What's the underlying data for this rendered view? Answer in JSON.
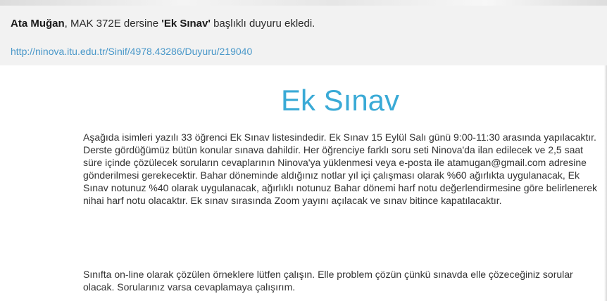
{
  "notice": {
    "author": "Ata Muğan",
    "text_before_title": ", MAK 372E dersine ",
    "title_quoted": "'Ek Sınav'",
    "text_after_title": " başlıklı duyuru ekledi.",
    "link": "http://ninova.itu.edu.tr/Sinif/4978.43286/Duyuru/219040"
  },
  "announcement": {
    "title": "Ek Sınav",
    "paragraph_1": "Aşağıda isimleri yazılı 33 öğrenci Ek Sınav listesindedir. Ek Sınav 15 Eylül Salı günü 9:00-11:30 arasında yapılacaktır. Derste gördüğümüz bütün konular sınava dahildir. Her öğrenciye farklı soru seti Ninova'da ilan edilecek ve 2,5 saat süre içinde çözülecek soruların cevaplarının Ninova'ya yüklenmesi veya e-posta ile atamugan@gmail.com adresine gönderilmesi gerekecektir. Bahar döneminde aldığınız notlar yıl içi çalışması olarak %60 ağırlıkta uygulanacak, Ek Sınav notunuz %40 olarak uygulanacak, ağırlıklı notunuz Bahar dönemi harf notu değerlendirmesine göre belirlenerek nihai harf notu olacaktır. Ek sınav sırasında Zoom yayını açılacak ve sınav bitince kapatılacaktır.",
    "paragraph_2": "Sınıfta on-line olarak çözülen örneklere lütfen çalışın. Elle problem çözün çünkü sınavda elle çözeceğiniz sorular olacak. Sorularınız varsa cevaplamaya çalışırım."
  }
}
